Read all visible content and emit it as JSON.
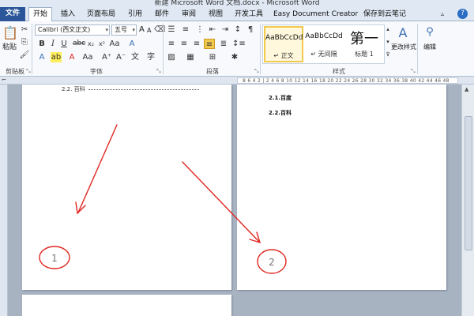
{
  "window": {
    "title": "新建 Microsoft Word 文档.docx - Microsoft Word"
  },
  "tabs": [
    "文件",
    "开始",
    "插入",
    "页面布局",
    "引用",
    "邮件",
    "审阅",
    "视图",
    "开发工具",
    "Easy Document Creator",
    "保存到云笔记"
  ],
  "ribbon": {
    "clipboard": {
      "paste": "粘贴",
      "label": "剪贴板"
    },
    "font": {
      "name": "Calibri (西文正文)",
      "size": "五号",
      "label": "字体",
      "grow": "A",
      "shrink": "A"
    },
    "paragraph": {
      "label": "段落"
    },
    "styles": {
      "items": [
        {
          "preview": "AaBbCcDd",
          "caption": "↵ 正文"
        },
        {
          "preview": "AaBbCcDd",
          "caption": "↵ 无间隔"
        },
        {
          "preview": "第一",
          "caption": "标题 1"
        }
      ],
      "change": "更改样式",
      "label": "样式"
    },
    "editing": {
      "label": "编辑"
    }
  },
  "ruler": {
    "ticks": "8 6 4 2 | 2 4 6 8 10 12 14 16 18 20 22 24 26 28 30 32 34 36 38 40 42 44 46 48"
  },
  "document": {
    "page1_toc": "2.2.  百科",
    "page2_headings": [
      "2.1.百度",
      "2.2.百科"
    ],
    "annotations": [
      "1",
      "2"
    ]
  },
  "colors": {
    "file_tab": "#2b579a",
    "annotation": "#e0261f"
  }
}
